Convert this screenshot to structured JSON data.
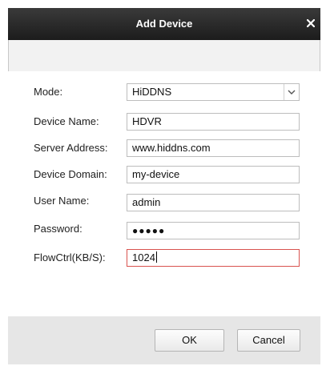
{
  "dialog": {
    "title": "Add Device",
    "close_icon": "close-icon"
  },
  "form": {
    "mode_label": "Mode:",
    "mode_value": "HiDDNS",
    "device_name_label": "Device Name:",
    "device_name_value": "HDVR",
    "server_address_label": "Server Address:",
    "server_address_value": "www.hiddns.com",
    "device_domain_label": "Device Domain:",
    "device_domain_value": "my-device",
    "user_name_label": "User Name:",
    "user_name_value": "admin",
    "password_label": "Password:",
    "password_value": "●●●●●",
    "flowctrl_label": "FlowCtrl(KB/S):",
    "flowctrl_value": "1024"
  },
  "buttons": {
    "ok_label": "OK",
    "cancel_label": "Cancel"
  },
  "colors": {
    "title_bar": "#2a2a2a",
    "active_border": "#d9534f",
    "footer": "#e6e6e6"
  }
}
